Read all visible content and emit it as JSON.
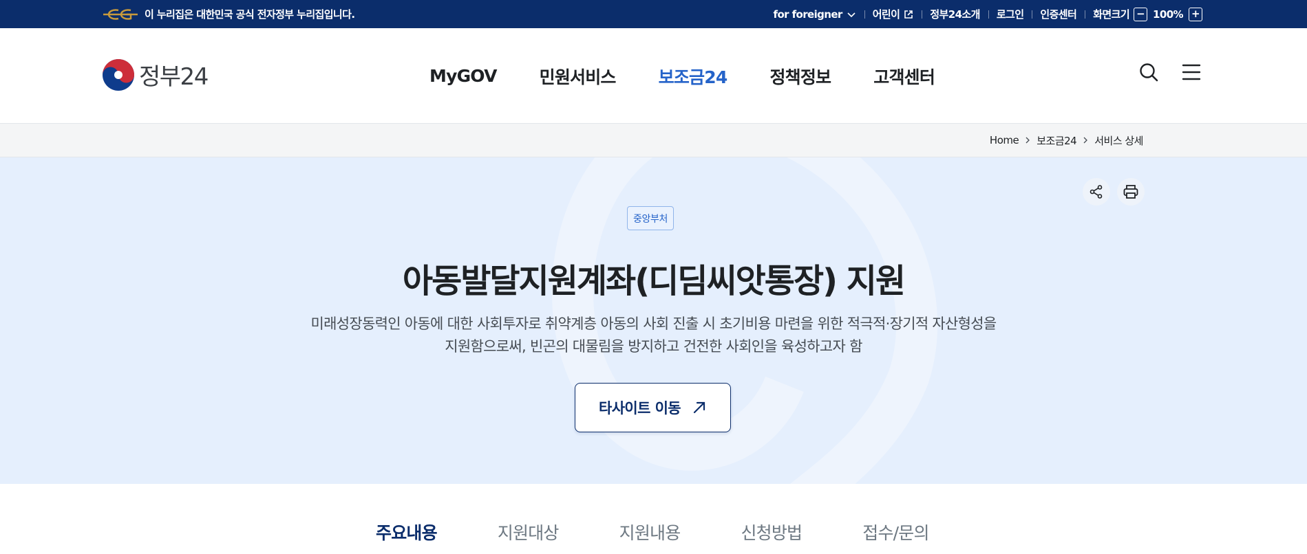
{
  "topbar": {
    "notice": "이 누리집은 대한민국 공식 전자정부 누리집입니다.",
    "links": {
      "foreigner": "for foreigner",
      "kids": "어린이",
      "about": "정부24소개",
      "login": "로그인",
      "cert": "인증센터",
      "zoom_label": "화면크기"
    },
    "zoom_minus": "−",
    "zoom_value": "100%",
    "zoom_plus": "+"
  },
  "header": {
    "logo_text": "정부24",
    "nav": [
      {
        "label": "MyGOV"
      },
      {
        "label": "민원서비스"
      },
      {
        "label": "보조금24"
      },
      {
        "label": "정책정보"
      },
      {
        "label": "고객센터"
      }
    ],
    "active_nav": "보조금24"
  },
  "breadcrumb": [
    "Home",
    "보조금24",
    "서비스 상세"
  ],
  "hero": {
    "badge": "중앙부처",
    "title": "아동발달지원계좌(디딤씨앗통장) 지원",
    "description": [
      "미래성장동력인 아동에 대한 사회투자로 취약계층 아동의 사회 진출 시 초기비용 마련을 위한 적극적·장기적 자산형성을",
      "지원함으로써, 빈곤의 대물림을 방지하고 건전한 사회인을 육성하고자 함"
    ],
    "button_label": "타사이트 이동"
  },
  "tabs": [
    {
      "label": "주요내용"
    },
    {
      "label": "지원대상"
    },
    {
      "label": "지원내용"
    },
    {
      "label": "신청방법"
    },
    {
      "label": "접수/문의"
    }
  ],
  "active_tab": "주요내용",
  "colors": {
    "topbar_bg": "#0b2d6b",
    "accent": "#2563c9",
    "hero_bg": "#e5effd",
    "logo_red": "#cd2e3a",
    "logo_blue": "#0f3c8c",
    "eg_gold": "#c89a3c"
  }
}
